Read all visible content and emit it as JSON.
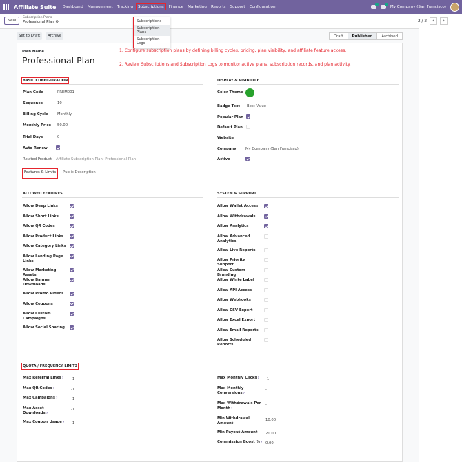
{
  "nav": {
    "app": "Affiliate Suite",
    "menus": [
      "Dashboard",
      "Management",
      "Tracking",
      "Subscriptions",
      "Finance",
      "Marketing",
      "Reports",
      "Support",
      "Configuration"
    ],
    "company": "My Company (San Francisco)"
  },
  "control": {
    "new": "New",
    "crumb_parent": "Subscription Plans",
    "crumb_current": "Professional Plan",
    "pager": "2 / 2"
  },
  "dropdown": [
    "Subscriptions",
    "Subscription Plans",
    "Subscription Logs"
  ],
  "status": {
    "set_draft": "Set to Draft",
    "archive": "Archive",
    "stages": [
      "Draft",
      "Published",
      "Archived"
    ]
  },
  "form": {
    "plan_name_label": "Plan Name",
    "plan_name": "Professional Plan",
    "note1": "1. Configure subscription plans by defining billing cycles, pricing, plan visibility, and affiliate feature access.",
    "note2": "2. Review Subscriptions and Subscription Logs to monitor active plans, subscription records, and plan activity.",
    "basic_title": "Basic Configuration",
    "display_title": "Display & Visibility",
    "basic": [
      [
        "Plan Code",
        "PREM001"
      ],
      [
        "Sequence",
        "10"
      ],
      [
        "Billing Cycle",
        "Monthly"
      ],
      [
        "Monthly Price",
        "50.00"
      ],
      [
        "Trial Days",
        "0"
      ],
      [
        "Auto Renew",
        ""
      ],
      [
        "Related Product",
        "Affiliate Subscription Plan: Professional Plan"
      ]
    ],
    "display": [
      [
        "Color Theme",
        ""
      ],
      [
        "Badge Text",
        "Best Value"
      ],
      [
        "Popular Plan",
        ""
      ],
      [
        "Default Plan",
        ""
      ],
      [
        "Website",
        ""
      ],
      [
        "Company",
        "My Company (San Francisco)"
      ],
      [
        "Active",
        ""
      ]
    ],
    "colors": {
      "theme": "#28a22c",
      "accent": "#71639e",
      "highlight": "#e5262e"
    },
    "tabs": [
      "Features & Limits",
      "Public Description"
    ],
    "allowed_title": "Allowed Features",
    "system_title": "System & Support",
    "allowed": [
      [
        "Allow Deep Links",
        true
      ],
      [
        "Allow Short Links",
        true
      ],
      [
        "Allow QR Codes",
        true
      ],
      [
        "Allow Product Links",
        true
      ],
      [
        "Allow Category Links",
        true
      ],
      [
        "Allow Landing Page Links",
        true
      ],
      [
        "Allow Marketing Assets",
        true
      ],
      [
        "Allow Banner Downloads",
        true
      ],
      [
        "Allow Promo Videos",
        true
      ],
      [
        "Allow Coupons",
        true
      ],
      [
        "Allow Custom Campaigns",
        true
      ],
      [
        "Allow Social Sharing",
        true
      ]
    ],
    "system": [
      [
        "Allow Wallet Access",
        true
      ],
      [
        "Allow Withdrawals",
        true
      ],
      [
        "Allow Analytics",
        true
      ],
      [
        "Allow Advanced Analytics",
        false
      ],
      [
        "Allow Live Reports",
        false
      ],
      [
        "Allow Priority Support",
        false
      ],
      [
        "Allow Custom Branding",
        false
      ],
      [
        "Allow White Label",
        false
      ],
      [
        "Allow API Access",
        false
      ],
      [
        "Allow Webhooks",
        false
      ],
      [
        "Allow CSV Export",
        false
      ],
      [
        "Allow Excel Export",
        false
      ],
      [
        "Allow Email Reports",
        false
      ],
      [
        "Allow Scheduled Reports",
        false
      ]
    ],
    "quota_title": "Quota / Frequency Limits",
    "quota_left": [
      [
        "Max Referral Links",
        "-1"
      ],
      [
        "Max QR Codes",
        "-1"
      ],
      [
        "Max Campaigns",
        "-1"
      ],
      [
        "Max Asset Downloads",
        "-1"
      ],
      [
        "Max Coupon Usage",
        "-1"
      ]
    ],
    "quota_right": [
      [
        "Max Monthly Clicks",
        "-1"
      ],
      [
        "Max Monthly Conversions",
        "-1"
      ],
      [
        "Max Withdrawals Per Month",
        "-1"
      ],
      [
        "Min Withdrawal Amount",
        "10.00"
      ],
      [
        "Min Payout Amount",
        "20.00"
      ],
      [
        "Commission Boost %",
        "0.00"
      ]
    ]
  }
}
